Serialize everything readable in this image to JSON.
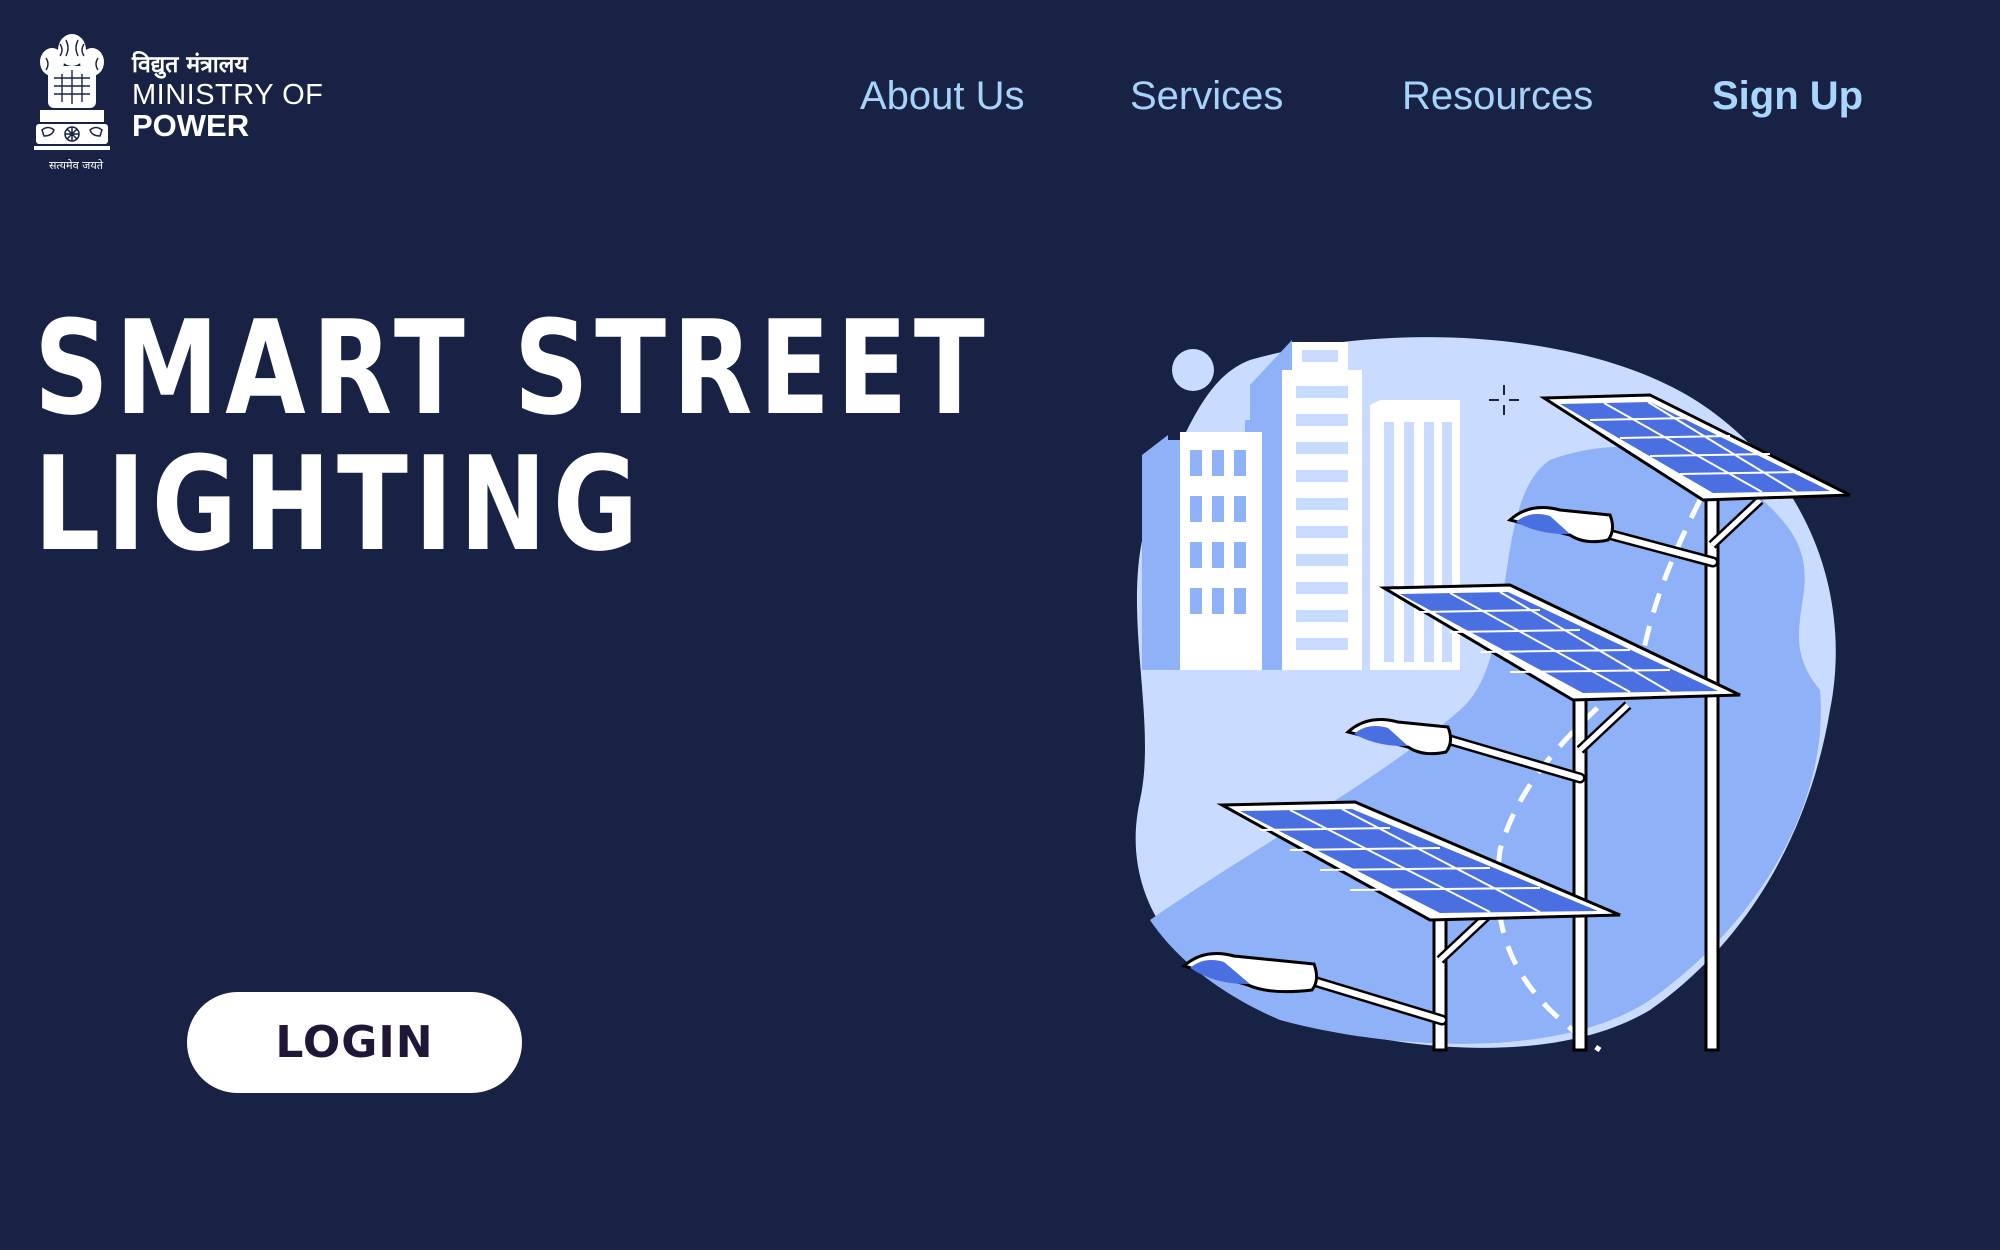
{
  "brand": {
    "hindi_name": "विद्युत मंत्रालय",
    "name_line1": "MINISTRY OF",
    "name_line2": "POWER",
    "emblem_motto": "सत्यमेव जयते"
  },
  "nav": {
    "items": [
      {
        "label": "About Us"
      },
      {
        "label": "Services"
      },
      {
        "label": "Resources"
      },
      {
        "label": "Sign Up"
      }
    ]
  },
  "hero": {
    "title_line1": "SMART STREET",
    "title_line2": "LIGHTING",
    "login_label": "LOGIN"
  },
  "colors": {
    "background": "#182244",
    "nav_text": "#a7d3fb",
    "button_bg": "#ffffff",
    "button_text": "#201637",
    "illustration_blob": "#c9dbff",
    "illustration_accent": "#8fb1f7",
    "solar_cell": "#4a6fe0"
  },
  "illustration": {
    "icon": "solar-street-lights-illustration"
  }
}
